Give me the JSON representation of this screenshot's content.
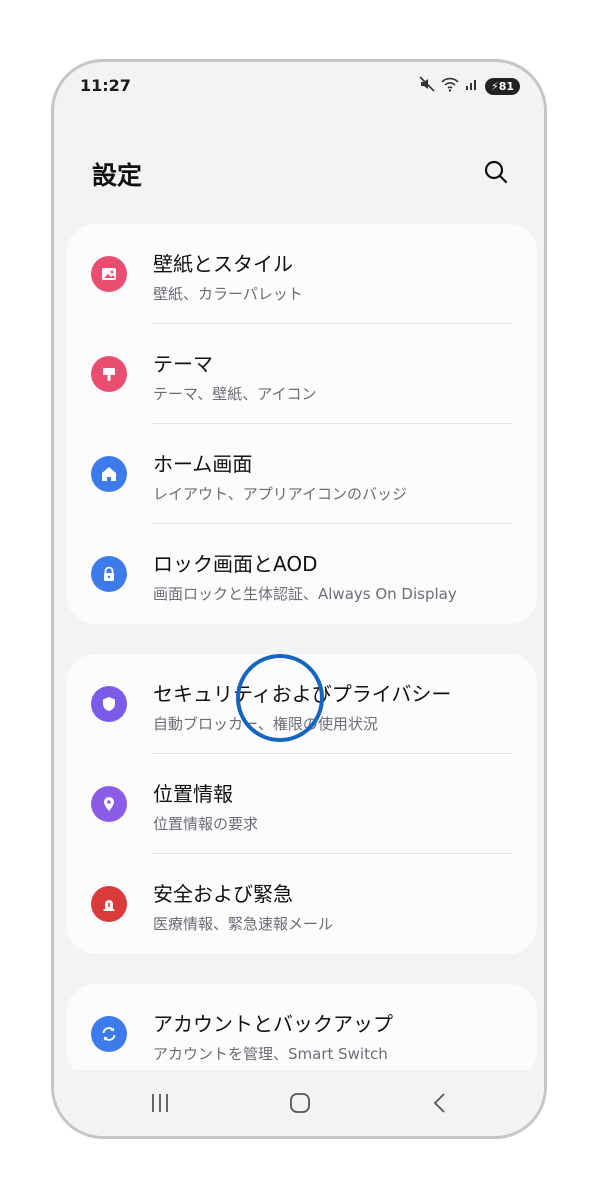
{
  "status_bar": {
    "time": "11:27",
    "battery": "81",
    "icons": [
      "mute-icon",
      "wifi-icon",
      "signal-icon",
      "battery-charging-icon"
    ]
  },
  "header": {
    "title": "設定",
    "search_icon": "search-icon"
  },
  "groups": [
    {
      "items": [
        {
          "title": "壁紙とスタイル",
          "subtitle": "壁紙、カラーパレット",
          "icon": "wallpaper-icon",
          "color": "#e94d6f"
        },
        {
          "title": "テーマ",
          "subtitle": "テーマ、壁紙、アイコン",
          "icon": "theme-brush-icon",
          "color": "#e94d6f"
        },
        {
          "title": "ホーム画面",
          "subtitle": "レイアウト、アプリアイコンのバッジ",
          "icon": "home-icon",
          "color": "#3d7bea"
        },
        {
          "title": "ロック画面とAOD",
          "subtitle": "画面ロックと生体認証、Always On Display",
          "icon": "lock-icon",
          "color": "#3d7bea"
        }
      ]
    },
    {
      "items": [
        {
          "title": "セキュリティおよびプライバシー",
          "subtitle": "自動ブロッカー、権限の使用状況",
          "icon": "shield-icon",
          "color": "#7a5ce8"
        },
        {
          "title": "位置情報",
          "subtitle": "位置情報の要求",
          "icon": "location-pin-icon",
          "color": "#8b5de6"
        },
        {
          "title": "安全および緊急",
          "subtitle": "医療情報、緊急速報メール",
          "icon": "emergency-icon",
          "color": "#d93a3a"
        }
      ]
    },
    {
      "items": [
        {
          "title": "アカウントとバックアップ",
          "subtitle": "アカウントを管理、Smart Switch",
          "icon": "sync-icon",
          "color": "#3d7bea"
        }
      ]
    }
  ],
  "nav_bar": {
    "recents_icon": "recents-icon",
    "home_icon": "home-button-icon",
    "back_icon": "back-icon"
  },
  "colors": {
    "background": "#f3f3f6",
    "card": "#fcfcfe",
    "focus_ring": "#1565c0"
  }
}
